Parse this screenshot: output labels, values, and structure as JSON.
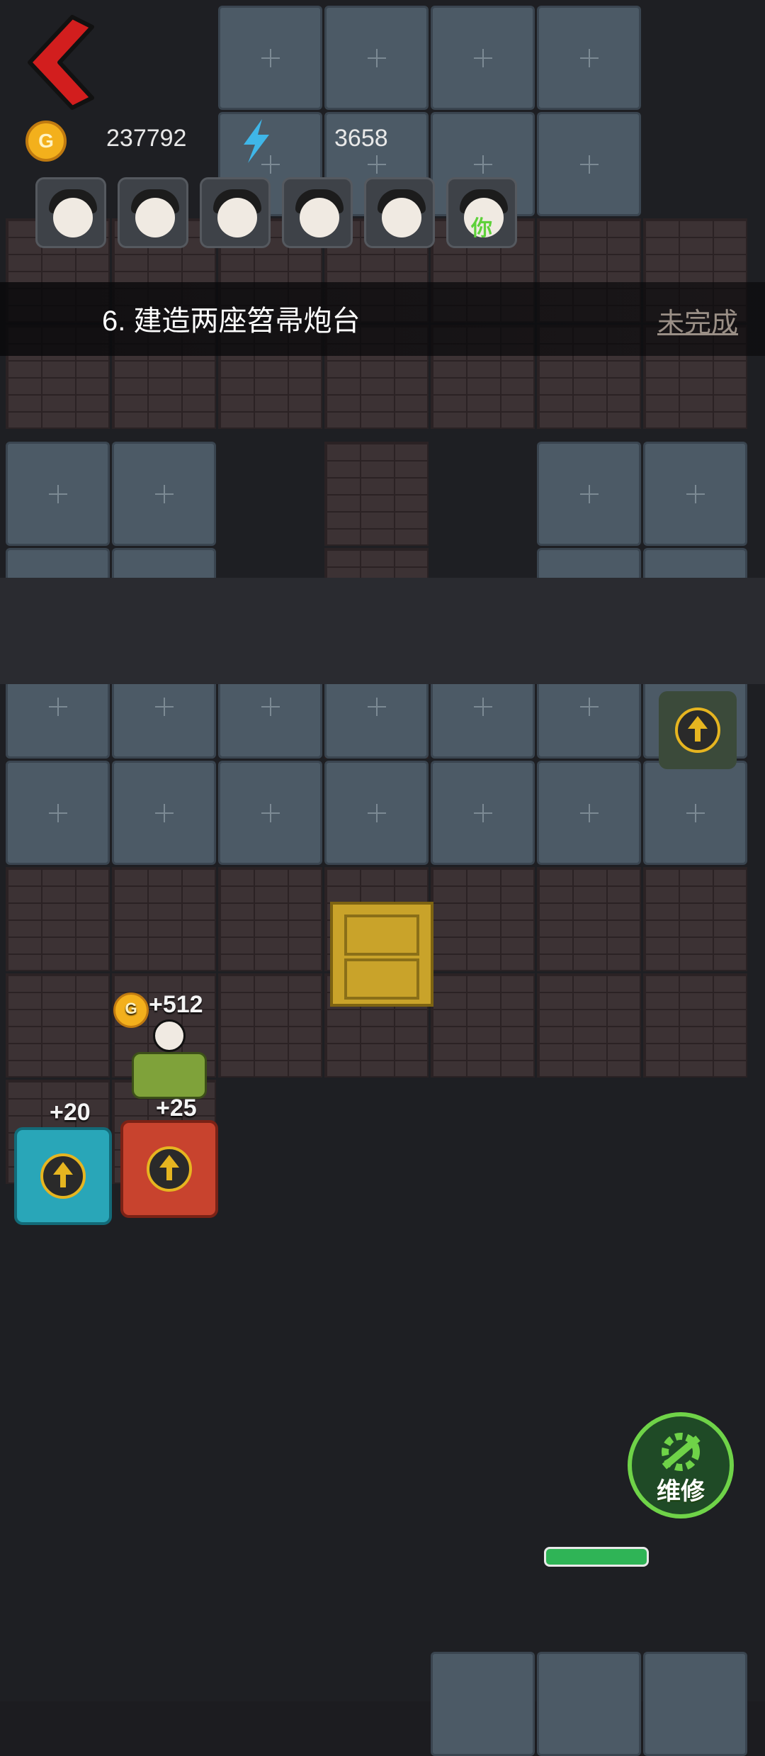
{
  "hud": {
    "coins": "237792",
    "energy": "3658",
    "coin_symbol": "G"
  },
  "avatars": [
    {
      "name": "avatar-1",
      "you": ""
    },
    {
      "name": "avatar-2",
      "you": ""
    },
    {
      "name": "avatar-3",
      "you": ""
    },
    {
      "name": "avatar-4",
      "you": ""
    },
    {
      "name": "avatar-5",
      "you": ""
    },
    {
      "name": "avatar-6",
      "you": "你"
    }
  ],
  "task": {
    "text": "6. 建造两座笤帚炮台",
    "status": "未完成"
  },
  "floating": {
    "coin_gain": "+512",
    "energy_gain_1": "+20",
    "energy_gain_2": "+25"
  },
  "repair_button": "维修",
  "colors": {
    "back": "#d21e1e",
    "repair_accent": "#6fd348",
    "coin": "#f3b01c",
    "energy": "#3fb6e8"
  }
}
